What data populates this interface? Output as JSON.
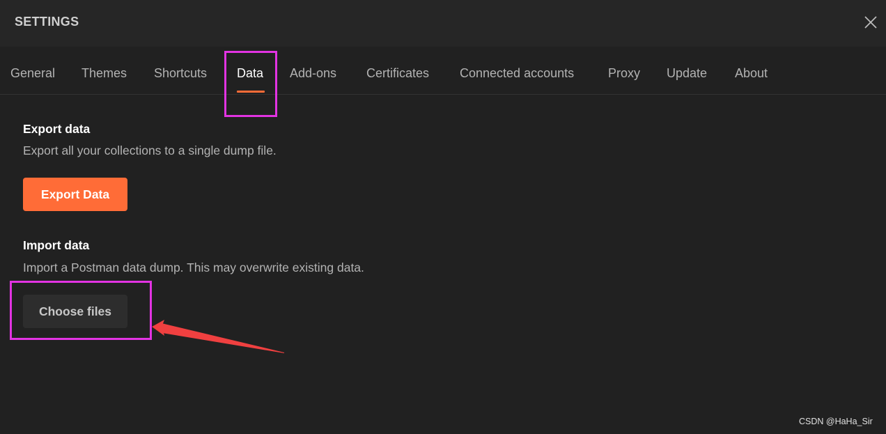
{
  "window": {
    "title": "SETTINGS",
    "close_icon": "close-icon"
  },
  "tabs": [
    {
      "label": "General"
    },
    {
      "label": "Themes"
    },
    {
      "label": "Shortcuts"
    },
    {
      "label": "Data",
      "active": true
    },
    {
      "label": "Add-ons"
    },
    {
      "label": "Certificates"
    },
    {
      "label": "Connected accounts"
    },
    {
      "label": "Proxy"
    },
    {
      "label": "Update"
    },
    {
      "label": "About"
    }
  ],
  "export_section": {
    "title": "Export data",
    "description": "Export all your collections to a single dump file.",
    "button_label": "Export Data"
  },
  "import_section": {
    "title": "Import data",
    "description": "Import a Postman data dump. This may overwrite existing data.",
    "button_label": "Choose files"
  },
  "colors": {
    "accent": "#ff6c37",
    "annotation_box": "#e233e2",
    "annotation_arrow": "#f04040",
    "background": "#212121"
  },
  "watermark": "CSDN @HaHa_Sir"
}
